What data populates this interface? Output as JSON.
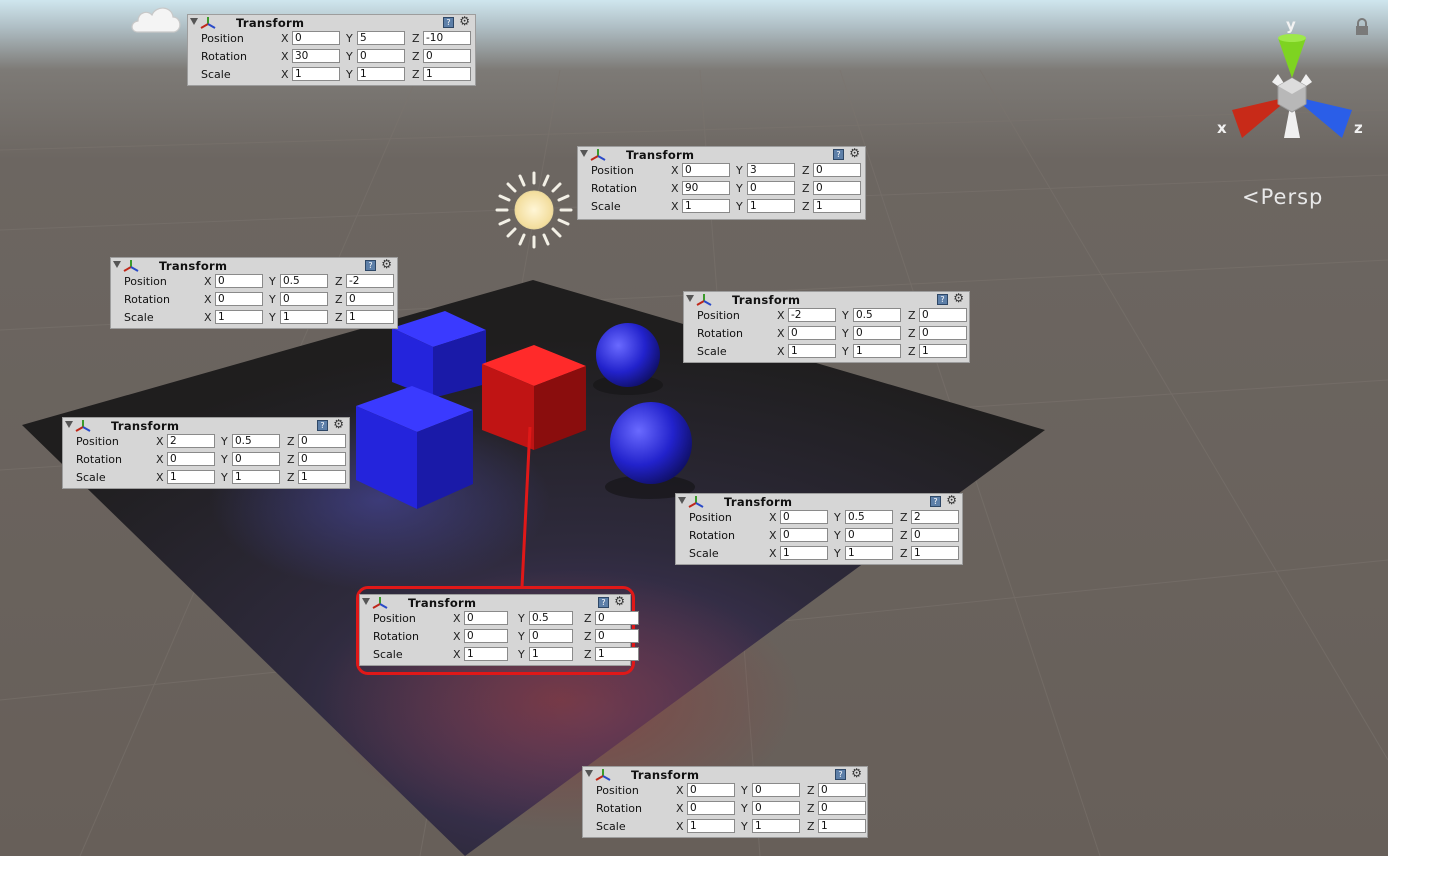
{
  "scene": {
    "view_mode": "Persp",
    "gizmo_axes": {
      "x": "x",
      "y": "y",
      "z": "z"
    },
    "icons": [
      "cloud-icon",
      "sun-icon",
      "lock-icon",
      "axis-gizmo-icon"
    ]
  },
  "colors": {
    "highlight": "#e01818",
    "cube_blue": "#1a1ad0",
    "cube_red": "#d41616",
    "panel_bg": "#d6d6d6"
  },
  "row_labels": {
    "position": "Position",
    "rotation": "Rotation",
    "scale": "Scale"
  },
  "axis_labels": {
    "x": "X",
    "y": "Y",
    "z": "Z"
  },
  "panels": [
    {
      "title": "Transform",
      "position": [
        "0",
        "5",
        "-10"
      ],
      "rotation": [
        "30",
        "0",
        "0"
      ],
      "scale": [
        "1",
        "1",
        "1"
      ]
    },
    {
      "title": "Transform",
      "position": [
        "0",
        "3",
        "0"
      ],
      "rotation": [
        "90",
        "0",
        "0"
      ],
      "scale": [
        "1",
        "1",
        "1"
      ]
    },
    {
      "title": "Transform",
      "position": [
        "0",
        "0.5",
        "-2"
      ],
      "rotation": [
        "0",
        "0",
        "0"
      ],
      "scale": [
        "1",
        "1",
        "1"
      ]
    },
    {
      "title": "Transform",
      "position": [
        "-2",
        "0.5",
        "0"
      ],
      "rotation": [
        "0",
        "0",
        "0"
      ],
      "scale": [
        "1",
        "1",
        "1"
      ]
    },
    {
      "title": "Transform",
      "position": [
        "2",
        "0.5",
        "0"
      ],
      "rotation": [
        "0",
        "0",
        "0"
      ],
      "scale": [
        "1",
        "1",
        "1"
      ]
    },
    {
      "title": "Transform",
      "position": [
        "0",
        "0.5",
        "2"
      ],
      "rotation": [
        "0",
        "0",
        "0"
      ],
      "scale": [
        "1",
        "1",
        "1"
      ]
    },
    {
      "title": "Transform",
      "position": [
        "0",
        "0.5",
        "0"
      ],
      "rotation": [
        "0",
        "0",
        "0"
      ],
      "scale": [
        "1",
        "1",
        "1"
      ]
    },
    {
      "title": "Transform",
      "position": [
        "0",
        "0",
        "0"
      ],
      "rotation": [
        "0",
        "0",
        "0"
      ],
      "scale": [
        "1",
        "1",
        "1"
      ]
    }
  ]
}
